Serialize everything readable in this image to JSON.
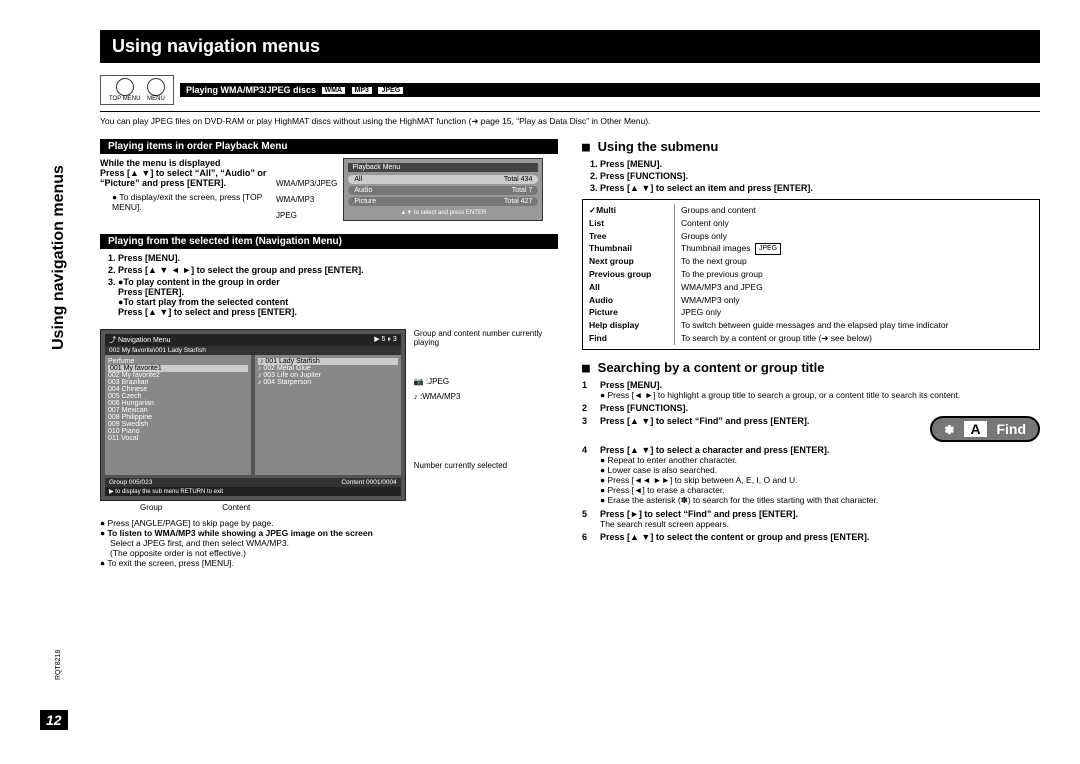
{
  "page": {
    "number": "12",
    "rqt": "RQT8218",
    "side_tab": "Using navigation menus",
    "title": "Using navigation menus"
  },
  "header": {
    "btn_topmenu": "TOP MENU",
    "btn_menu": "MENU",
    "section_title": "Playing WMA/MP3/JPEG discs",
    "formats": [
      "WMA",
      "MP3",
      "JPEG"
    ],
    "note": "You can play JPEG files on DVD-RAM or play HighMAT discs without using the HighMAT function (➜ page 15, “Play as Data Disc” in Other Menu)."
  },
  "left": {
    "playback_head": "Playing items in order Playback Menu",
    "while_text": "While the menu is displayed",
    "press_select": "Press [▲ ▼] to select “All”, “Audio” or “Picture” and press [ENTER].",
    "disp_exit": "To display/exit the screen, press [TOP MENU].",
    "row_labels": [
      "WMA/MP3/JPEG",
      "WMA/MP3",
      "JPEG"
    ],
    "playback_screen": {
      "title": "Playback Menu",
      "rows": [
        {
          "l": "All",
          "r": "Total 434"
        },
        {
          "l": "Audio",
          "r": "Total 7"
        },
        {
          "l": "Picture",
          "r": "Total 427"
        }
      ],
      "foot": "▲▼ to select and press ENTER"
    },
    "nav_head": "Playing from the selected item (Navigation Menu)",
    "steps": [
      "Press [MENU].",
      "Press [▲ ▼ ◄ ►] to select the group and press [ENTER].",
      "●To play content in the group in order\nPress [ENTER].\n●To start play from the selected content\nPress [▲ ▼] to select and press [ENTER]."
    ],
    "anno_top": "Group and content number currently playing",
    "anno_jpeg": "JPEG",
    "anno_wma": ":WMA/MP3",
    "anno_num": "Number currently selected",
    "nav_screen": {
      "title": "Navigation Menu",
      "path": "002 My favorite\\001 Lady Starfish",
      "groups": [
        "Perfume",
        "001 My favorite1",
        "002 My favorite2",
        "003 Brazilian",
        "004 Chinese",
        "005 Czech",
        "006 Hungarian",
        "007 Mexican",
        "008 Philippine",
        "009 Swedish",
        "010 Piano",
        "011 Vocal"
      ],
      "tracks": [
        "001 Lady Starfish",
        "002 Metal Glue",
        "003 Life on Jupiter",
        "004 Starperson"
      ],
      "foot_l": "Group   005/023",
      "foot_r": "Content 0001/0004",
      "foot_note": "▶ to display the sub menu   RETURN to exit"
    },
    "labels_below": {
      "group": "Group",
      "content": "Content"
    },
    "tips": [
      "Press [ANGLE/PAGE] to skip page by page.",
      "To listen to WMA/MP3 while showing a JPEG image on the screen",
      "Select a JPEG first, and then select WMA/MP3.",
      "(The opposite order is not effective.)",
      "To exit the screen, press [MENU]."
    ]
  },
  "right": {
    "using_submenu": "Using the submenu",
    "sub_steps": [
      "Press [MENU].",
      "Press [FUNCTIONS].",
      "Press [▲ ▼] to select an item and press [ENTER]."
    ],
    "submenu_items": [
      {
        "l": "Multi",
        "r": "Groups and content"
      },
      {
        "l": "List",
        "r": "Content only"
      },
      {
        "l": "Tree",
        "r": "Groups only"
      },
      {
        "l": "Thumbnail",
        "r": "Thumbnail images JPEG"
      },
      {
        "l": "Next group",
        "r": "To the next group"
      },
      {
        "l": "Previous group",
        "r": "To the previous group"
      },
      {
        "l": "All",
        "r": "WMA/MP3 and JPEG"
      },
      {
        "l": "Audio",
        "r": "WMA/MP3 only"
      },
      {
        "l": "Picture",
        "r": "JPEG only"
      },
      {
        "l": "Help display",
        "r": "To switch between guide messages and the elapsed play time indicator"
      },
      {
        "l": "Find",
        "r": "To search by a content or group title (➜ see below)"
      }
    ],
    "search_title": "Searching by a content or group title",
    "search_steps": [
      {
        "n": "1",
        "t": "Press [MENU].",
        "sub": [
          "Press [◄ ►] to highlight a group title to search a group, or a content title to search its content."
        ]
      },
      {
        "n": "2",
        "t": "Press [FUNCTIONS]."
      },
      {
        "n": "3",
        "t": "Press [▲ ▼] to select “Find” and press [ENTER]."
      },
      {
        "n": "4",
        "t": "Press [▲ ▼] to select a character and press [ENTER].",
        "sub": [
          "Repeat to enter another character.",
          "Lower case is also searched.",
          "Press [◄◄ ►►] to skip between A, E, I, O and U.",
          "Press [◄] to erase a character.",
          "Erase the asterisk (✽) to search for the titles starting with that character."
        ]
      },
      {
        "n": "5",
        "t": "Press [►] to select “Find” and press [ENTER].",
        "sub": [
          "The search result screen appears."
        ]
      },
      {
        "n": "6",
        "t": "Press [▲ ▼] to select the content or group and press [ENTER]."
      }
    ],
    "find_label": "Find",
    "find_char": "A",
    "find_star": "✽"
  }
}
